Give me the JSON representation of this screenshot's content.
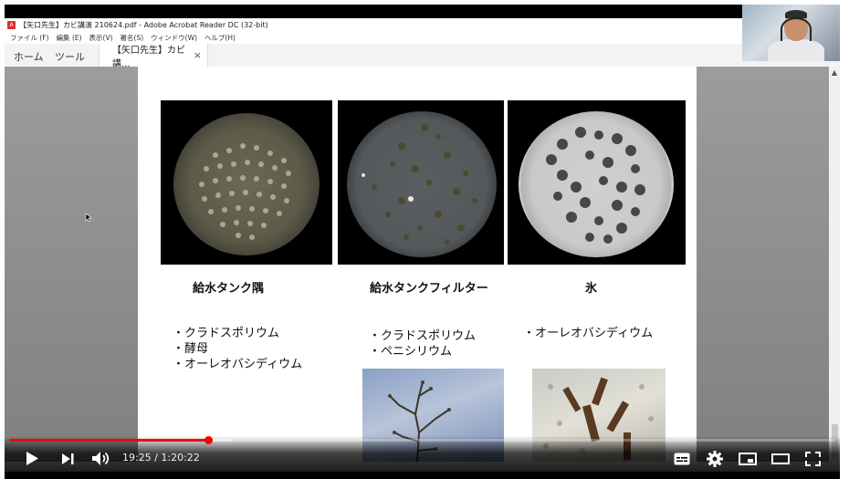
{
  "window": {
    "title": "【矢口先生】カビ講演 210624.pdf - Adobe Acrobat Reader DC (32-bit)",
    "pdf_icon": "A"
  },
  "menu": [
    "ファイル (F)",
    "編集 (E)",
    "表示(V)",
    "署名(S)",
    "ウィンドウ(W)",
    "ヘルプ(H)"
  ],
  "tabs": {
    "home": "ホーム",
    "tools": "ツール",
    "document": "【矢口先生】カビ講...",
    "close": "×"
  },
  "slide": {
    "captions": [
      "給水タンク隅",
      "給水タンクフィルター",
      "氷"
    ],
    "species_1": [
      "・クラドスポリウム",
      "・酵母",
      "・オーレオバシディウム"
    ],
    "species_2": [
      "・クラドスポリウム",
      "・ペニシリウム"
    ],
    "species_3": [
      "・オーレオバシディウム"
    ]
  },
  "player": {
    "time": "19:25 / 1:20:22",
    "played_fraction": 0.2415,
    "buffered_fraction": 0.268,
    "progress_color": "#ff0000"
  },
  "icons": {
    "play": "play-icon",
    "next": "next-icon",
    "volume": "volume-icon",
    "subtitles": "subtitles-icon",
    "settings": "settings-icon",
    "miniplayer": "miniplayer-icon",
    "theater": "theater-icon",
    "fullscreen": "fullscreen-icon"
  }
}
